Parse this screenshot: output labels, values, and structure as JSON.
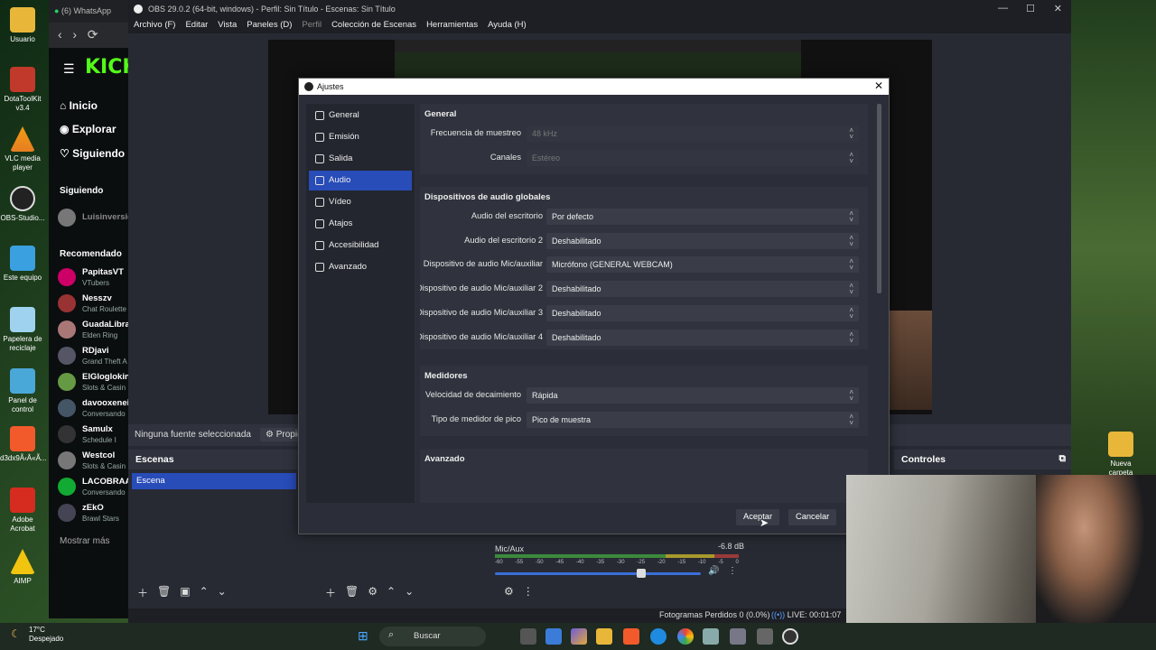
{
  "desktop": {
    "icons": [
      {
        "label": "Usuario"
      },
      {
        "label": "DotaToolKit v3.4"
      },
      {
        "label": "VLC media player"
      },
      {
        "label": "OBS-Studio..."
      },
      {
        "label": "Este equipo"
      },
      {
        "label": "Papelera de reciclaje"
      },
      {
        "label": "Panel de control"
      },
      {
        "label": "d3dx9Ã‹Â«Ã..."
      },
      {
        "label": "Adobe Acrobat"
      },
      {
        "label": "AIMP"
      }
    ],
    "right_icon": "Nueva carpeta"
  },
  "browser": {
    "tab_title": "(6) WhatsApp",
    "logo": "KICK",
    "nav": [
      "Inicio",
      "Explorar",
      "Siguiendo"
    ],
    "following_label": "Siguiendo",
    "following_user": "Luisinversio",
    "recommended_label": "Recomendado",
    "channels": [
      {
        "name": "PapitasVT",
        "game": "VTubers"
      },
      {
        "name": "Nesszv",
        "game": "Chat Roulette"
      },
      {
        "name": "GuadaLibra",
        "game": "Elden Ring"
      },
      {
        "name": "RDjavi",
        "game": "Grand Theft A"
      },
      {
        "name": "ElGloglokin",
        "game": "Slots & Casin"
      },
      {
        "name": "davooxenei",
        "game": "Conversando"
      },
      {
        "name": "Samulx",
        "game": "Schedule I"
      },
      {
        "name": "Westcol",
        "game": "Slots & Casin"
      },
      {
        "name": "LACOBRAA",
        "game": "Conversando"
      },
      {
        "name": "zEkO",
        "game": "Brawl Stars"
      }
    ],
    "show_more": "Mostrar más"
  },
  "obs": {
    "title": "OBS 29.0.2 (64-bit, windows) - Perfil: Sin Título - Escenas: Sin Título",
    "menu": [
      "Archivo (F)",
      "Editar",
      "Vista",
      "Paneles (D)",
      "Perfil",
      "Colección de Escenas",
      "Herramientas",
      "Ayuda (H)"
    ],
    "no_source": "Ninguna fuente seleccionada",
    "properties": "Propiedades",
    "scenes_title": "Escenas",
    "scene_item": "Escena",
    "controls_title": "Controles",
    "mixer": {
      "source": "Mic/Aux",
      "db": "-6.8 dB",
      "ticks": [
        "-60",
        "-55",
        "-50",
        "-45",
        "-40",
        "-35",
        "-30",
        "-25",
        "-20",
        "-15",
        "-10",
        "-5",
        "0"
      ],
      "volume_fraction": 0.69
    },
    "status": {
      "dropped": "Fotogramas Perdidos 0 (0.0%)",
      "live": "LIVE: 00:01:07"
    }
  },
  "dialog": {
    "title": "Ajustes",
    "sidebar": [
      {
        "label": "General",
        "icon": "gear-icon"
      },
      {
        "label": "Emisión",
        "icon": "antenna-icon"
      },
      {
        "label": "Salida",
        "icon": "output-icon"
      },
      {
        "label": "Audio",
        "icon": "speaker-icon",
        "active": true
      },
      {
        "label": "Vídeo",
        "icon": "monitor-icon"
      },
      {
        "label": "Atajos",
        "icon": "keyboard-icon"
      },
      {
        "label": "Accesibilidad",
        "icon": "accessibility-icon"
      },
      {
        "label": "Avanzado",
        "icon": "wrench-icon"
      }
    ],
    "general": {
      "title": "General",
      "sample_rate_label": "Frecuencia de muestreo",
      "sample_rate": "48 kHz",
      "channels_label": "Canales",
      "channels": "Estéreo"
    },
    "global_devices": {
      "title": "Dispositivos de audio globales",
      "rows": [
        {
          "label": "Audio del escritorio",
          "value": "Por defecto"
        },
        {
          "label": "Audio del escritorio 2",
          "value": "Deshabilitado"
        },
        {
          "label": "Dispositivo de audio Mic/auxiliar",
          "value": "Micrófono (GENERAL WEBCAM)"
        },
        {
          "label": "Dispositivo de audio Mic/auxiliar 2",
          "value": "Deshabilitado"
        },
        {
          "label": "Dispositivo de audio Mic/auxiliar 3",
          "value": "Deshabilitado"
        },
        {
          "label": "Dispositivo de audio Mic/auxiliar 4",
          "value": "Deshabilitado"
        }
      ]
    },
    "meters": {
      "title": "Medidores",
      "decay_label": "Velocidad de decaimiento",
      "decay": "Rápida",
      "peak_label": "Tipo de medidor de pico",
      "peak": "Pico de muestra"
    },
    "advanced_title": "Avanzado",
    "accept": "Aceptar",
    "cancel": "Cancelar"
  },
  "taskbar": {
    "temp": "17°C",
    "weather": "Despejado",
    "search": "Buscar"
  }
}
